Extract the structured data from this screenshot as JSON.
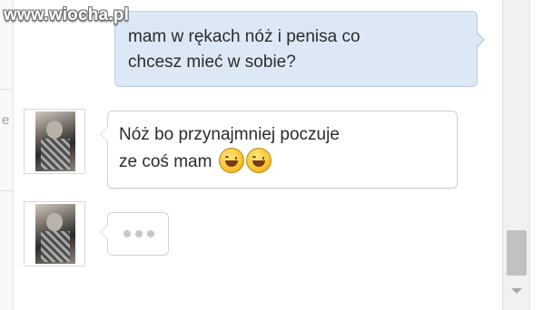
{
  "watermark": "www.wiocha.pl",
  "left_fragment": "e",
  "messages": {
    "outgoing": {
      "line1": "mam w rękach nóż i penisa co",
      "line2": "chcesz mieć w sobie?"
    },
    "incoming": {
      "line1": "Nóż bo przynajmniej poczuje",
      "line2": "ze coś mam",
      "emoji": [
        "laughing-tears-emoji",
        "laughing-tears-emoji"
      ]
    },
    "typing_indicator": {
      "dots": 3
    }
  },
  "icons": {
    "avatar": "profile-photo",
    "scroll_thumb": "scroll-thumb",
    "scroll_down": "chevron-down-icon"
  }
}
